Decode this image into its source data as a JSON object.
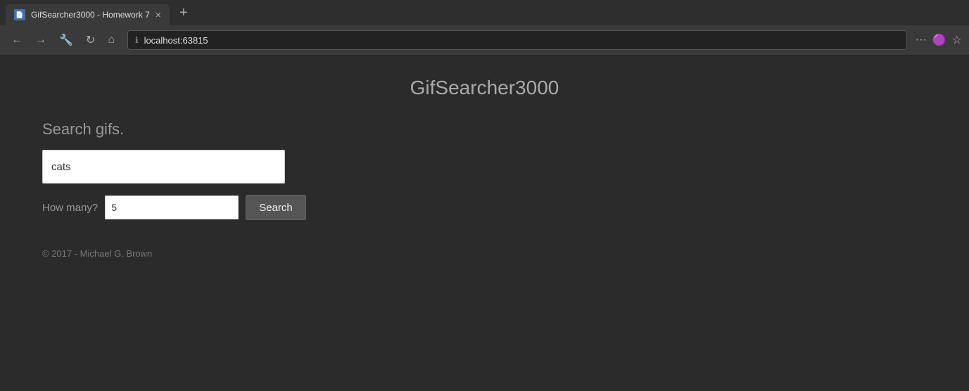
{
  "browser": {
    "tab_title": "GifSearcher3000 - Homework 7",
    "tab_close": "×",
    "tab_new": "+",
    "address": "localhost:63815",
    "nav_back": "←",
    "nav_forward": "→",
    "nav_tools": "🔧",
    "nav_refresh": "↻",
    "nav_home": "⌂",
    "nav_more": "···",
    "nav_pocket": "🟣",
    "nav_star": "☆"
  },
  "page": {
    "app_title": "GifSearcher3000",
    "search_heading": "Search gifs.",
    "search_placeholder": "",
    "search_value": "cats",
    "how_many_label": "How many?",
    "quantity_value": "5",
    "search_button_label": "Search",
    "footer": "© 2017 - Michael G. Brown"
  }
}
